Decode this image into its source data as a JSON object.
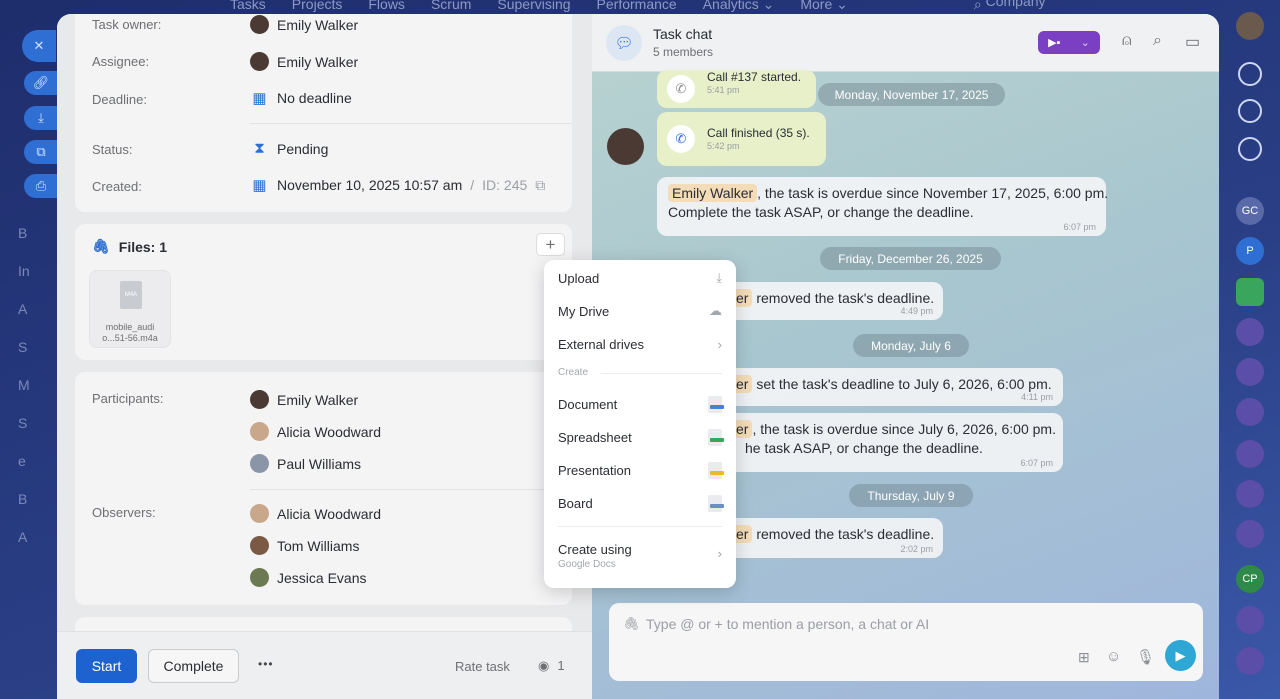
{
  "background": {
    "top_nav": [
      "Tasks",
      "Projects",
      "Flows",
      "Scrum",
      "Supervising",
      "Performance",
      "Analytics ⌄",
      "More ⌄"
    ],
    "company_search": "Company",
    "left_rail_letters": [
      "B",
      "In",
      "A",
      "S",
      "M",
      "S",
      "e",
      "B",
      "A"
    ],
    "right_rail_badges": [
      "GC",
      "P",
      "CP"
    ]
  },
  "task": {
    "task_owner_label": "Task owner:",
    "task_owner": "Emily Walker",
    "assignee_label": "Assignee:",
    "assignee": "Emily Walker",
    "deadline_label": "Deadline:",
    "deadline": "No deadline",
    "status_label": "Status:",
    "status": "Pending",
    "created_label": "Created:",
    "created": "November 10, 2025 10:57 am",
    "id_sep": "/",
    "id": "ID: 245",
    "files_title": "Files: 1",
    "file_name_line1": "mobile_audi",
    "file_name_line2": "o...51-56.m4a",
    "file_badge": "M4A",
    "participants_label": "Participants:",
    "participants": [
      "Emily Walker",
      "Alicia Woodward",
      "Paul Williams"
    ],
    "observers_label": "Observers:",
    "observers": [
      "Alicia Woodward",
      "Tom Williams",
      "Jessica Evans"
    ]
  },
  "footer": {
    "start": "Start",
    "complete": "Complete",
    "more": "•••",
    "rate": "Rate task",
    "views": "1"
  },
  "chat": {
    "title": "Task chat",
    "members": "5 members",
    "call_started": "Call #137 started.",
    "call_started_time": "5:41 pm",
    "date1": "Monday, November 17, 2025",
    "call_finished": "Call finished (35 s).",
    "call_finished_time": "5:42 pm",
    "msg1_mention": "Emily Walker",
    "msg1_line1": ", the task is overdue since November 17, 2025, 6:00 pm.",
    "msg1_line2": "Complete the task ASAP, or change the deadline.",
    "msg1_time": "6:07 pm",
    "date2": "Friday, December 26, 2025",
    "msg2_mention": "er",
    "msg2_text": "removed the task's deadline.",
    "msg2_time": "4:49 pm",
    "date3": "Monday, July 6",
    "msg3_mention": "er",
    "msg3_text": "set the task's deadline to July 6, 2026, 6:00 pm.",
    "msg3_time": "4:11 pm",
    "msg4_mention": "er",
    "msg4_line1": ", the task is overdue since July 6, 2026, 6:00 pm.",
    "msg4_line2": "he task ASAP, or change the deadline.",
    "msg4_time": "6:07 pm",
    "date4": "Thursday, July 9",
    "msg5_mention": "er",
    "msg5_text": "removed the task's deadline.",
    "msg5_time": "2:02 pm",
    "composer_placeholder": "Type @ or + to mention a person, a chat or AI"
  },
  "menu": {
    "upload": "Upload",
    "my_drive": "My Drive",
    "external_drives": "External drives",
    "create_header": "Create",
    "document": "Document",
    "spreadsheet": "Spreadsheet",
    "presentation": "Presentation",
    "board": "Board",
    "create_using": "Create using",
    "google_docs": "Google Docs"
  },
  "colors": {
    "primary": "#1e62d0",
    "accent_purple": "#7b3fc4",
    "doc_blue": "#4a7fd8",
    "sheet_green": "#3aa55c",
    "pres_yellow": "#e8b92e",
    "board_blue": "#6a8fc4"
  }
}
